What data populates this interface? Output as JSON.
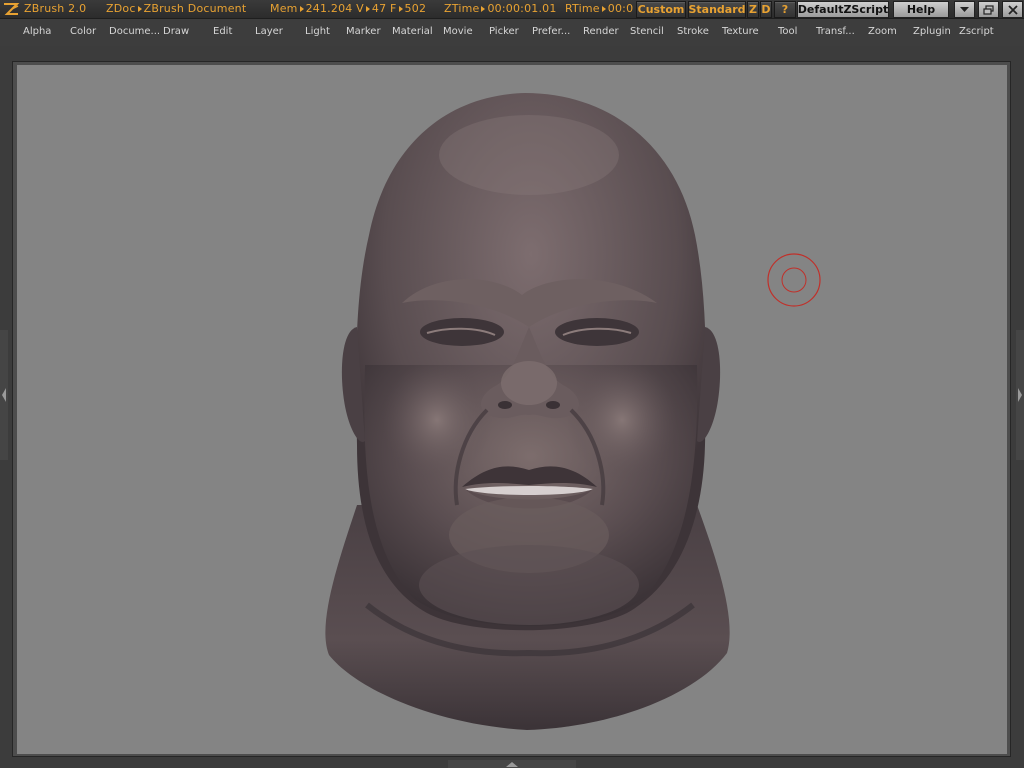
{
  "titlebar": {
    "app_name": "ZBrush 2.0",
    "zdoc_label": "ZDoc",
    "zdoc_value": "ZBrush Document",
    "mem_label": "Mem",
    "mem_value": "241.204",
    "v_label": "V",
    "v_value": "47",
    "f_label": "F",
    "f_value": "502",
    "ztime_label": "ZTime",
    "ztime_value": "00:00:01.01",
    "rtime_label": "RTime",
    "rtime_value": "00:0",
    "custom_label": "Custom",
    "standard_label": "Standard",
    "z_label": "Z",
    "d_label": "D",
    "question_label": "?",
    "script_label": "DefaultZScript",
    "help_label": "Help"
  },
  "menubar": {
    "items": [
      "Alpha",
      "Color",
      "Docume...",
      "Draw",
      "Edit",
      "Layer",
      "Light",
      "Marker",
      "Material",
      "Movie",
      "Picker",
      "Prefer...",
      "Render",
      "Stencil",
      "Stroke",
      "Texture",
      "Tool",
      "Transf...",
      "Zoom",
      "Zplugin",
      "Zscript"
    ]
  },
  "colors": {
    "accent": "#e8a232",
    "canvas": "#848484",
    "cursor": "#c0302a",
    "model": "#5b4f52"
  },
  "icons": {
    "logo": "zbrush-logo-icon",
    "minimize": "minimize-icon",
    "restore": "restore-icon",
    "close": "close-icon",
    "brush_cursor": "brush-cursor-icon"
  }
}
